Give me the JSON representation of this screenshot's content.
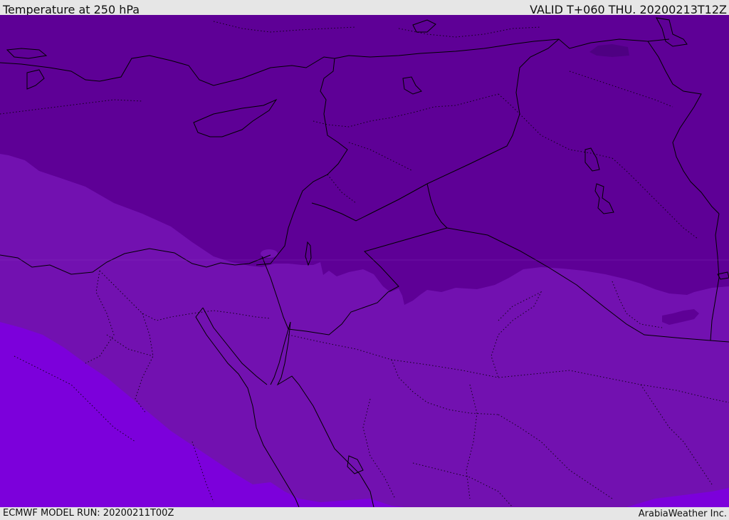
{
  "header": {
    "title": "Temperature at 250 hPa",
    "valid_time": "VALID T+060 THU. 20200213T12Z"
  },
  "footer": {
    "model_run": "ECMWF MODEL RUN: 20200211T00Z",
    "credit": "ArabiaWeather Inc."
  },
  "map": {
    "region": "Eastern Mediterranean / Middle East",
    "colors": {
      "band_coldest": "#5e0096",
      "band_middle": "#7211b0",
      "band_warmest": "#7c00db",
      "coastline": "#000000",
      "borders": "#000000"
    }
  }
}
